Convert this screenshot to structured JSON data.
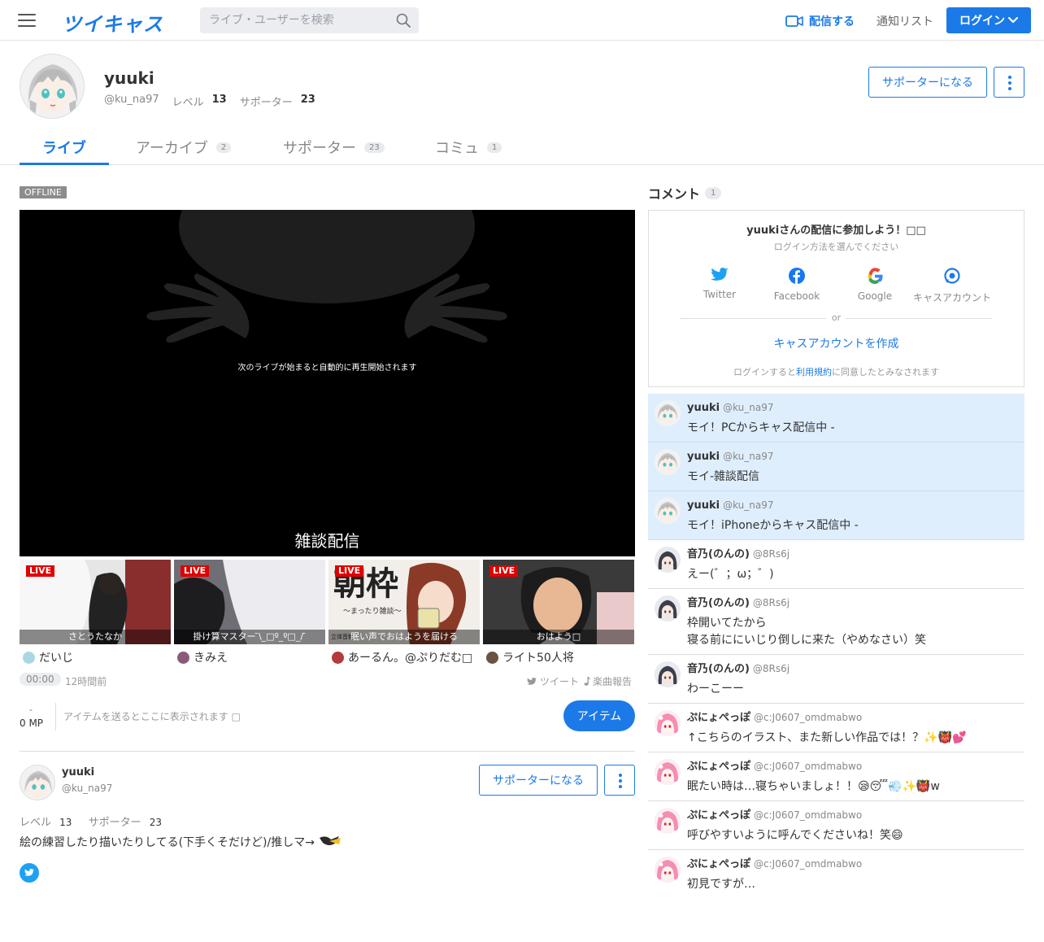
{
  "header": {
    "logo": "ツイキャス",
    "search_placeholder": "ライブ・ユーザーを検索",
    "broadcast_label": "配信する",
    "notify_label": "通知リスト",
    "login_label": "ログイン"
  },
  "profile": {
    "name": "yuuki",
    "handle": "@ku_na97",
    "level_label": "レベル",
    "level": "13",
    "supporter_label": "サポーター",
    "supporters": "23",
    "become_supporter": "サポーターになる"
  },
  "tabs": [
    {
      "label": "ライブ",
      "count": ""
    },
    {
      "label": "アーカイブ",
      "count": "2"
    },
    {
      "label": "サポーター",
      "count": "23"
    },
    {
      "label": "コミュ",
      "count": "1"
    }
  ],
  "player": {
    "status": "OFFLINE",
    "message": "次のライブが始まると自動的に再生開始されます",
    "title": "雑談配信"
  },
  "thumbs": [
    {
      "live": "LIVE",
      "caption": "さとうたなか",
      "user": "だいじ",
      "color": "#d8d8d8"
    },
    {
      "live": "LIVE",
      "caption": "掛け算マスター ̄\\_□º_º□_/ ̄",
      "user": "きみえ",
      "color": "#9a9aa0"
    },
    {
      "live": "LIVE",
      "caption": "眠い声でおはようを届ける",
      "user": "あーるん。@ぷりだむ□",
      "color": "#f0ebe6",
      "big_text": "朝枠",
      "small_text": "〜まったり雑談〜",
      "corner_text": "立体音響"
    },
    {
      "live": "LIVE",
      "caption": "おはよう□",
      "user": "ライト50人将",
      "color": "#2c2c2c"
    }
  ],
  "stats": {
    "timer": "00:00",
    "ago": "12時間前",
    "tweet": "ツイート",
    "song": "楽曲報告",
    "mp_dash": "-",
    "mp": "0 MP",
    "item_message": "アイテムを送るとここに表示されます □",
    "item_button": "アイテム"
  },
  "bio": {
    "name": "yuuki",
    "handle": "@ku_na97",
    "level_label": "レベル",
    "level": "13",
    "supporter_label": "サポーター",
    "supporters": "23",
    "text": "絵の練習したり描いたりしてる(下手くそだけど)/推しマ→",
    "become_supporter": "サポーターになる"
  },
  "comments_panel": {
    "title": "コメント",
    "count": "1",
    "card_title": "yuukiさんの配信に参加しよう！□□",
    "card_sub": "ログイン方法を選んでください",
    "providers": [
      "Twitter",
      "Facebook",
      "Google",
      "キャスアカウント"
    ],
    "or": "or",
    "create_account": "キャスアカウントを作成",
    "terms_prefix": "ログインすると",
    "terms_link": "利用規約",
    "terms_suffix": "に同意したとみなされます"
  },
  "comments": [
    {
      "name": "yuuki",
      "handle": "@ku_na97",
      "text": "モイ！PCからキャス配信中 -",
      "highlight": true,
      "av": "yuuki"
    },
    {
      "name": "yuuki",
      "handle": "@ku_na97",
      "text": "モイ-雑談配信",
      "highlight": true,
      "av": "yuuki"
    },
    {
      "name": "yuuki",
      "handle": "@ku_na97",
      "text": "モイ！iPhoneからキャス配信中 -",
      "highlight": true,
      "av": "yuuki"
    },
    {
      "name": "音乃(のんの)",
      "handle": "@8Rs6j",
      "text": "えー(゛；ω；゛)",
      "highlight": false,
      "av": "nonno"
    },
    {
      "name": "音乃(のんの)",
      "handle": "@8Rs6j",
      "text": "枠開いてたから\n寝る前ににいじり倒しに来た（やめなさい）笑",
      "highlight": false,
      "av": "nonno"
    },
    {
      "name": "音乃(のんの)",
      "handle": "@8Rs6j",
      "text": "わーこーー",
      "highlight": false,
      "av": "nonno"
    },
    {
      "name": "ぷにょぺっぽ",
      "handle": "@c:J0607_omdmabwo",
      "text": "↑こちらのイラスト、また新しい作品では！？✨👹💕",
      "highlight": false,
      "av": "puni"
    },
    {
      "name": "ぷにょぺっぽ",
      "handle": "@c:J0607_omdmabwo",
      "text": "眠たい時は…寝ちゃいましょ！！😪😴💨✨👹w",
      "highlight": false,
      "av": "puni"
    },
    {
      "name": "ぷにょぺっぽ",
      "handle": "@c:J0607_omdmabwo",
      "text": "呼びやすいように呼んでくださいね！笑😄",
      "highlight": false,
      "av": "puni"
    },
    {
      "name": "ぷにょぺっぽ",
      "handle": "@c:J0607_omdmabwo",
      "text": "初見ですが…",
      "highlight": false,
      "av": "puni"
    }
  ],
  "colors": {
    "accent": "#1b7ae8",
    "live_red": "#e00000",
    "highlight": "#dfeefd"
  }
}
